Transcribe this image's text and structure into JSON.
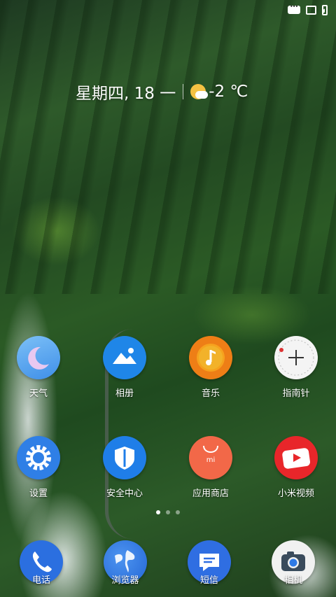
{
  "status_bar": {
    "icons": [
      "message-icon",
      "sim-icon",
      "battery-charging-icon"
    ]
  },
  "widget": {
    "date": "星期四, 18 一",
    "temperature": "-2 ℃",
    "weather_icon": "partly-sunny-icon"
  },
  "apps": [
    {
      "label": "天气",
      "icon": "weather-moon-icon"
    },
    {
      "label": "相册",
      "icon": "gallery-icon"
    },
    {
      "label": "音乐",
      "icon": "music-icon"
    },
    {
      "label": "指南针",
      "icon": "compass-icon"
    },
    {
      "label": "设置",
      "icon": "settings-gear-icon"
    },
    {
      "label": "安全中心",
      "icon": "security-shield-icon"
    },
    {
      "label": "应用商店",
      "icon": "app-store-icon"
    },
    {
      "label": "小米视频",
      "icon": "video-play-icon"
    }
  ],
  "page_indicator": {
    "count": 3,
    "active": 1
  },
  "dock": [
    {
      "label": "电话",
      "icon": "phone-icon"
    },
    {
      "label": "浏览器",
      "icon": "browser-globe-icon"
    },
    {
      "label": "短信",
      "icon": "messages-icon"
    },
    {
      "label": "相机",
      "icon": "camera-icon"
    }
  ],
  "colors": {
    "weather_bg": "#5aa8f0",
    "gallery_bg": "#1f86e8",
    "music_bg": "#f08a1a",
    "compass_bg": "#f4f4f4",
    "settings_bg": "#2f7fe6",
    "security_bg": "#1f7ee8",
    "store_bg": "#f26848",
    "video_bg": "#e8262a",
    "phone_bg": "#2b6fe0",
    "browser_bg": "#2e7ae6",
    "sms_bg": "#2f6ee2",
    "camera_bg": "#f1f1f1"
  }
}
